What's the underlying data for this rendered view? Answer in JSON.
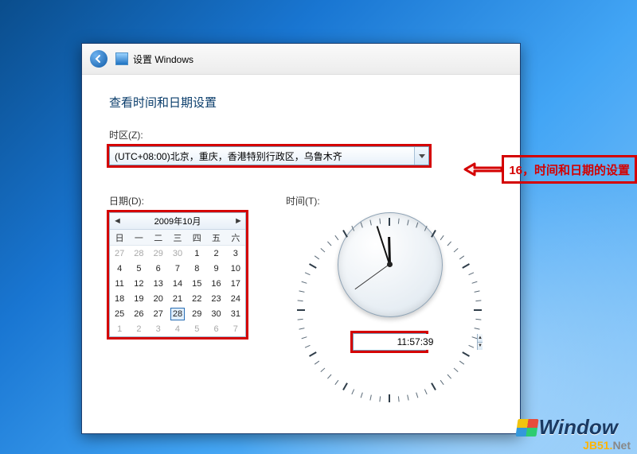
{
  "header": {
    "title": "设置 Windows"
  },
  "page_title": "查看时间和日期设置",
  "tz": {
    "label": "时区(Z):",
    "selected": "(UTC+08:00)北京，重庆，香港特别行政区，乌鲁木齐"
  },
  "date": {
    "label": "日期(D):",
    "month_title": "2009年10月",
    "dow": [
      "日",
      "一",
      "二",
      "三",
      "四",
      "五",
      "六"
    ],
    "grid": [
      [
        {
          "d": 27,
          "o": 1
        },
        {
          "d": 28,
          "o": 1
        },
        {
          "d": 29,
          "o": 1
        },
        {
          "d": 30,
          "o": 1
        },
        {
          "d": 1
        },
        {
          "d": 2
        },
        {
          "d": 3
        }
      ],
      [
        {
          "d": 4
        },
        {
          "d": 5
        },
        {
          "d": 6
        },
        {
          "d": 7
        },
        {
          "d": 8
        },
        {
          "d": 9
        },
        {
          "d": 10
        }
      ],
      [
        {
          "d": 11
        },
        {
          "d": 12
        },
        {
          "d": 13
        },
        {
          "d": 14
        },
        {
          "d": 15
        },
        {
          "d": 16
        },
        {
          "d": 17
        }
      ],
      [
        {
          "d": 18
        },
        {
          "d": 19
        },
        {
          "d": 20
        },
        {
          "d": 21
        },
        {
          "d": 22
        },
        {
          "d": 23
        },
        {
          "d": 24
        }
      ],
      [
        {
          "d": 25
        },
        {
          "d": 26
        },
        {
          "d": 27
        },
        {
          "d": 28,
          "s": 1
        },
        {
          "d": 29
        },
        {
          "d": 30
        },
        {
          "d": 31
        }
      ],
      [
        {
          "d": 1,
          "o": 1
        },
        {
          "d": 2,
          "o": 1
        },
        {
          "d": 3,
          "o": 1
        },
        {
          "d": 4,
          "o": 1
        },
        {
          "d": 5,
          "o": 1
        },
        {
          "d": 6,
          "o": 1
        },
        {
          "d": 7,
          "o": 1
        }
      ]
    ]
  },
  "time": {
    "label": "时间(T):",
    "value": "11:57:39",
    "hour": 11,
    "minute": 57,
    "second": 39
  },
  "annotation": "16，时间和日期的设置",
  "brand": "Window",
  "watermark_a": "JB51.",
  "watermark_b": "Net"
}
